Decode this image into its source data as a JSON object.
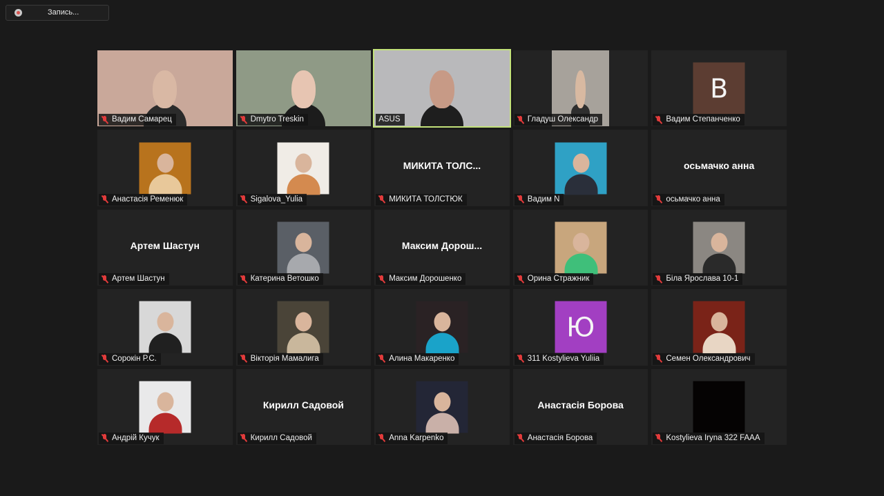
{
  "recording": {
    "label": "Запись..."
  },
  "participants": [
    {
      "name": "Вадим Самарец",
      "type": "video",
      "bg": "#c9a89a",
      "skin": "#d9b8a4",
      "shirt": "#2b2b2b"
    },
    {
      "name": "Dmytro Treskin",
      "type": "video",
      "bg": "#8f9a86",
      "skin": "#e7c5b2",
      "shirt": "#1c1c1c"
    },
    {
      "name": "ASUS",
      "type": "video",
      "active": true,
      "plain": true,
      "bg": "#b9b9bb",
      "skin": "#c79a86",
      "shirt": "#1e1e1e"
    },
    {
      "name": "Гладуш Олександр",
      "type": "video-small",
      "bg": "#a7a29b",
      "skin": "#d8b9a1",
      "shirt": "#2e2e2e"
    },
    {
      "name": "Вадим Степанченко",
      "type": "letter",
      "letter": "В",
      "color": "#5c3d32"
    },
    {
      "name": "Анастасія Ременюк",
      "type": "photo",
      "color": "#b8731d",
      "accent": "#e8c89a"
    },
    {
      "name": "Sigalova_Yulia",
      "type": "photo",
      "color": "#f0ece6",
      "accent": "#d48a4f"
    },
    {
      "name": "МИКИТА ТОЛСТЮК",
      "type": "text",
      "display": "МИКИТА  ТОЛС..."
    },
    {
      "name": "Вадим N",
      "type": "photo",
      "color": "#2fa1c5",
      "accent": "#2a2f3a"
    },
    {
      "name": "осьмачко анна",
      "type": "text",
      "display": "осьмачко анна"
    },
    {
      "name": "Артем Шастун",
      "type": "text",
      "display": "Артем Шастун"
    },
    {
      "name": "Катерина Ветошко",
      "type": "photo",
      "color": "#5a5f66",
      "accent": "#a7a9ad"
    },
    {
      "name": "Максим Дорошенко",
      "type": "text",
      "display": "Максим  Дорош..."
    },
    {
      "name": "Орина Стражник",
      "type": "photo",
      "color": "#c8a67d",
      "accent": "#3fbf7a"
    },
    {
      "name": "Біла Ярослава 10-1",
      "type": "photo",
      "color": "#8b8782",
      "accent": "#2a2a2a"
    },
    {
      "name": "Сорокін Р.С.",
      "type": "photo",
      "color": "#d8d8d8",
      "accent": "#202020"
    },
    {
      "name": "Вікторія Мамалига",
      "type": "photo",
      "color": "#4a4438",
      "accent": "#c9b79c"
    },
    {
      "name": "Алина Макаренко",
      "type": "photo",
      "color": "#2a2224",
      "accent": "#1aa3c9"
    },
    {
      "name": "311 Kostylieva Yuliia",
      "type": "letter",
      "letter": "Ю",
      "color": "#a23fc2"
    },
    {
      "name": "Семен Олександрович",
      "type": "photo",
      "color": "#7a2318",
      "accent": "#e8d6c4"
    },
    {
      "name": "Андрій Кучук",
      "type": "photo",
      "color": "#e9e9ea",
      "accent": "#b62a2a"
    },
    {
      "name": "Кирилл Садовой",
      "type": "text",
      "display": "Кирилл Садовой"
    },
    {
      "name": "Anna Karpenko",
      "type": "photo",
      "color": "#232636",
      "accent": "#c9b0a8"
    },
    {
      "name": "Анастасія Борова",
      "type": "text",
      "display": "Анастасія Борова"
    },
    {
      "name": "Kostylieva Iryna 322 FAAA",
      "type": "photo",
      "color": "#050303",
      "accent": "#050303"
    }
  ]
}
